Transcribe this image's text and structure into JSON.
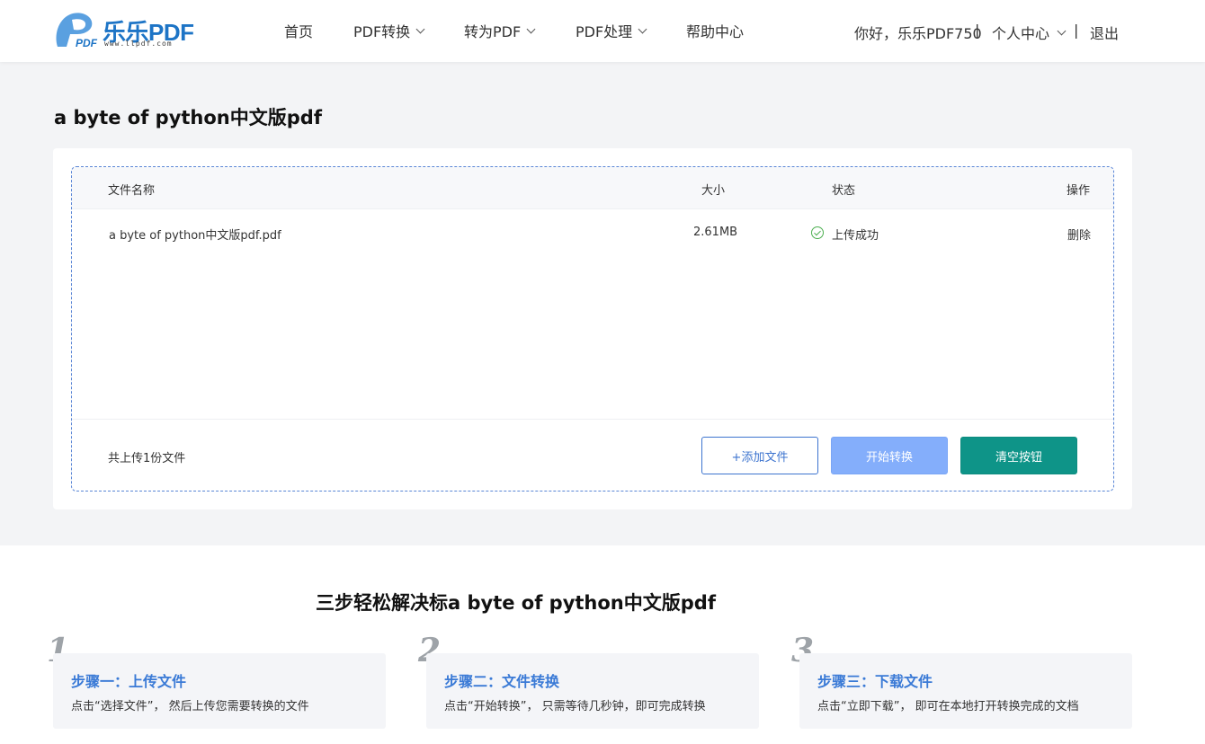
{
  "header": {
    "logo_text": "乐乐PDF",
    "logo_url": "www.llpdf.com",
    "nav": [
      {
        "label": "首页",
        "has_dropdown": false
      },
      {
        "label": "PDF转换",
        "has_dropdown": true
      },
      {
        "label": "转为PDF",
        "has_dropdown": true
      },
      {
        "label": "PDF处理",
        "has_dropdown": true
      },
      {
        "label": "帮助中心",
        "has_dropdown": false
      }
    ],
    "greeting": "你好，乐乐PDF750",
    "user_center": "个人中心",
    "logout": "退出",
    "separator": "|"
  },
  "page_title": "a byte of python中文版pdf",
  "file_table": {
    "columns": {
      "name": "文件名称",
      "size": "大小",
      "status": "状态",
      "action": "操作"
    },
    "rows": [
      {
        "name": "a byte of python中文版pdf.pdf",
        "size": "2.61MB",
        "status": "上传成功",
        "action": "删除"
      }
    ],
    "count_text": "共上传1份文件",
    "buttons": {
      "add": "+添加文件",
      "start": "开始转换",
      "clear": "清空按钮"
    }
  },
  "steps_section": {
    "title": "三步轻松解决标a byte of python中文版pdf",
    "steps": [
      {
        "num": "1",
        "title": "步骤一：上传文件",
        "desc": "点击“选择文件”，  然后上传您需要转换的文件"
      },
      {
        "num": "2",
        "title": "步骤二：文件转换",
        "desc": "点击“开始转换”，  只需等待几秒钟，即可完成转换"
      },
      {
        "num": "3",
        "title": "步骤三：下载文件",
        "desc": "点击“立即下载”，  即可在本地打开转换完成的文档"
      }
    ]
  },
  "colors": {
    "brand_blue": "#1d74c6",
    "accent_blue": "#3d74cf",
    "start_button": "#84aefb",
    "clear_button": "#0e9488",
    "success_green": "#4caf50"
  }
}
